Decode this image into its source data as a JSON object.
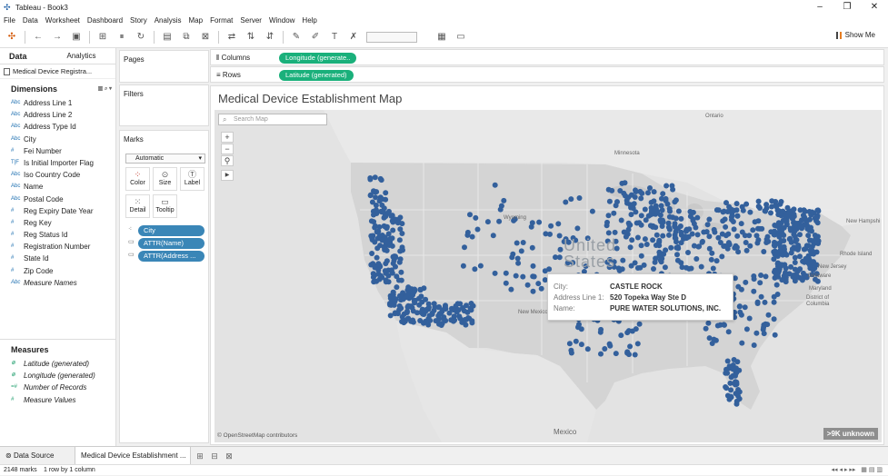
{
  "window": {
    "title": "Tableau - Book3"
  },
  "menu": [
    "File",
    "Data",
    "Worksheet",
    "Dashboard",
    "Story",
    "Analysis",
    "Map",
    "Format",
    "Server",
    "Window",
    "Help"
  ],
  "toolbar": {
    "show_me": "Show Me"
  },
  "left": {
    "tab_data": "Data",
    "tab_analytics": "Analytics",
    "datasource": "Medical Device Registra...",
    "dimensions_header": "Dimensions",
    "dimensions": [
      {
        "type": "Abc",
        "name": "Address Line 1"
      },
      {
        "type": "Abc",
        "name": "Address Line 2"
      },
      {
        "type": "Abc",
        "name": "Address Type Id"
      },
      {
        "type": "Abc",
        "name": "City"
      },
      {
        "type": "#",
        "name": "Fei Number"
      },
      {
        "type": "T|F",
        "name": "Is Initial Importer Flag"
      },
      {
        "type": "Abc",
        "name": "Iso Country Code"
      },
      {
        "type": "Abc",
        "name": "Name"
      },
      {
        "type": "Abc",
        "name": "Postal Code"
      },
      {
        "type": "#",
        "name": "Reg Expiry Date Year"
      },
      {
        "type": "#",
        "name": "Reg Key"
      },
      {
        "type": "#",
        "name": "Reg Status Id"
      },
      {
        "type": "#",
        "name": "Registration Number"
      },
      {
        "type": "#",
        "name": "State Id"
      },
      {
        "type": "#",
        "name": "Zip Code"
      },
      {
        "type": "Abc",
        "name": "Measure Names"
      }
    ],
    "measures_header": "Measures",
    "measures": [
      {
        "type": "⊕",
        "name": "Latitude (generated)"
      },
      {
        "type": "⊕",
        "name": "Longitude (generated)"
      },
      {
        "type": "=#",
        "name": "Number of Records"
      },
      {
        "type": "#",
        "name": "Measure Values"
      }
    ]
  },
  "cards": {
    "pages": "Pages",
    "filters": "Filters",
    "marks": "Marks",
    "marks_type": "Automatic",
    "buttons": {
      "color": "Color",
      "size": "Size",
      "label": "Label",
      "detail": "Detail",
      "tooltip": "Tooltip"
    },
    "mark_pills": [
      "City",
      "ATTR(Name)",
      "ATTR(Address ..."
    ]
  },
  "shelves": {
    "columns_label": "Columns",
    "columns_pill": "Longitude (generate..",
    "rows_label": "Rows",
    "rows_pill": "Latitude (generated)"
  },
  "viz": {
    "title": "Medical Device Establishment Map",
    "search_placeholder": "Search Map",
    "map_labels": {
      "country": "United States",
      "ontario": "Ontario",
      "minnesota": "Minnesota",
      "wyoming": "Wyoming",
      "new_hampshire": "New Hampshi",
      "rhode_island": "Rhode Island",
      "new_jersey": "New Jersey",
      "delaware": "Delaware",
      "maryland": "Maryland",
      "district": "District of Columbia",
      "mexico_city": "Mexico",
      "new_mexico": "New Mexico"
    },
    "credit": "© OpenStreetMap contributors",
    "unknown": ">9K unknown",
    "tooltip": {
      "city_k": "City:",
      "city_v": "CASTLE ROCK",
      "addr_k": "Address Line 1:",
      "addr_v": "520 Topeka Way Ste D",
      "name_k": "Name:",
      "name_v": "PURE WATER SOLUTIONS, INC."
    },
    "point_color": "#33609c"
  },
  "tabs": {
    "datasource": "Data Source",
    "sheet": "Medical Device Establishment ..."
  },
  "status": {
    "marks": "2148 marks",
    "dims": "1 row by 1 column"
  }
}
